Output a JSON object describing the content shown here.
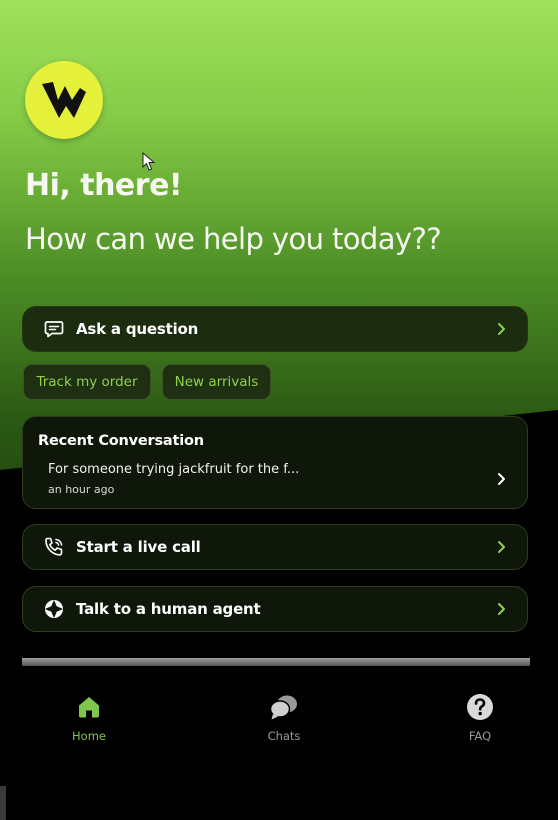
{
  "header": {
    "greeting": "Hi, there!",
    "subtitle": "How can we help you today??"
  },
  "actions": {
    "ask_label": "Ask a question",
    "chips": [
      "Track my order",
      "New arrivals"
    ],
    "live_call_label": "Start a live call",
    "human_agent_label": "Talk to a human agent"
  },
  "recent": {
    "title": "Recent Conversation",
    "preview": "For someone trying jackfruit for the f...",
    "time": "an hour ago"
  },
  "nav": {
    "items": [
      {
        "label": "Home",
        "icon": "home-icon",
        "active": true
      },
      {
        "label": "Chats",
        "icon": "chats-icon",
        "active": false
      },
      {
        "label": "FAQ",
        "icon": "faq-icon",
        "active": false
      }
    ]
  },
  "colors": {
    "accent": "#8fd14f",
    "logo_bg": "#e4f03a",
    "card_bg": "#0f170a"
  }
}
